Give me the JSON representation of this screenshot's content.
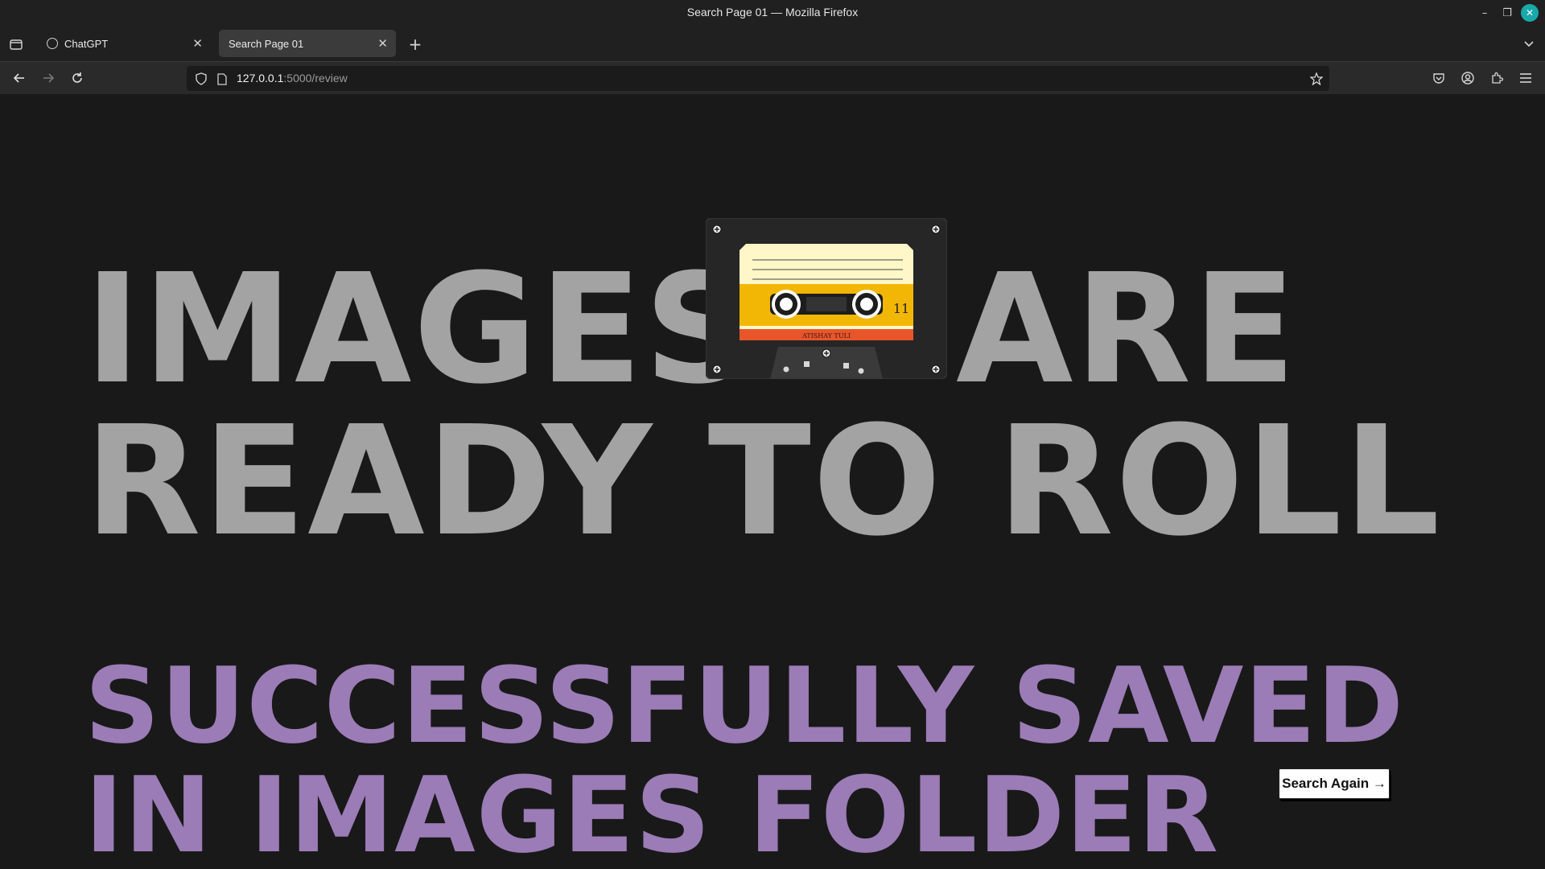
{
  "window": {
    "title": "Search Page 01 — Mozilla Firefox"
  },
  "tabs": [
    {
      "label": "ChatGPT",
      "active": false
    },
    {
      "label": "Search Page 01",
      "active": true
    }
  ],
  "urlbar": {
    "host": "127.0.0.1",
    "path": ":5000/review"
  },
  "headline": {
    "word1": "IMAGES",
    "word2": "ARE",
    "line2": "READY TO ROLL"
  },
  "cassette": {
    "number": "11",
    "label": "ATISHAY TULI"
  },
  "success_message": "SUCCESSFULLY SAVED IN IMAGES FOLDER",
  "search_again_label": "Search Again →",
  "colors": {
    "background": "#191919",
    "headline": "#a3a3a3",
    "success": "#9b7cb6",
    "cassette_yellow": "#f2b705",
    "cassette_orange": "#e8552a",
    "cassette_cream": "#fff7c8"
  }
}
